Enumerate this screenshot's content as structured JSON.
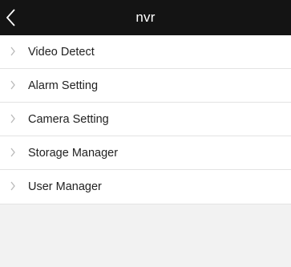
{
  "header": {
    "title": "nvr",
    "back_icon": "chevron-left-icon",
    "background": "#141414"
  },
  "menu": {
    "item_icon": "chevron-right-icon",
    "items": [
      {
        "label": "Video Detect"
      },
      {
        "label": "Alarm Setting"
      },
      {
        "label": "Camera Setting"
      },
      {
        "label": "Storage Manager"
      },
      {
        "label": "User Manager"
      }
    ]
  },
  "page": {
    "background": "#f2f2f2"
  }
}
